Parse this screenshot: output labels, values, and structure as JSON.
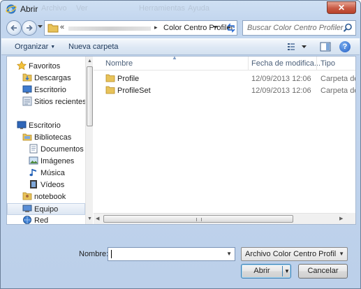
{
  "window": {
    "title": "Abrir",
    "ghost_menu": [
      "Archivo",
      "Ver",
      "Herramientas",
      "Ayuda"
    ],
    "close_glyph": "✕"
  },
  "address": {
    "chevron": "«",
    "separator": "▸",
    "current_folder": "Color Centro Profiler",
    "search_placeholder": "Buscar Color Centro Profiler"
  },
  "toolbar": {
    "organize_label": "Organizar",
    "new_folder_label": "Nueva carpeta",
    "help_glyph": "?"
  },
  "nav": {
    "items": [
      {
        "label": "Favoritos",
        "icon": "star-icon"
      },
      {
        "label": "Descargas",
        "icon": "downloads-folder-icon"
      },
      {
        "label": "Escritorio",
        "icon": "desktop-icon"
      },
      {
        "label": "Sitios recientes",
        "icon": "recent-places-icon"
      },
      {
        "label": "Escritorio",
        "icon": "desktop-icon"
      },
      {
        "label": "Bibliotecas",
        "icon": "libraries-icon"
      },
      {
        "label": "Documentos",
        "icon": "documents-icon"
      },
      {
        "label": "Imágenes",
        "icon": "pictures-icon"
      },
      {
        "label": "Música",
        "icon": "music-icon"
      },
      {
        "label": "Vídeos",
        "icon": "videos-icon"
      },
      {
        "label": "notebook",
        "icon": "user-folder-icon"
      },
      {
        "label": "Equipo",
        "icon": "computer-icon"
      },
      {
        "label": "Red",
        "icon": "network-icon"
      }
    ]
  },
  "files": {
    "columns": {
      "name": "Nombre",
      "date": "Fecha de modifica...",
      "type": "Tipo"
    },
    "rows": [
      {
        "name": "Profile",
        "date": "12/09/2013 12:06",
        "type": "Carpeta de a"
      },
      {
        "name": "ProfileSet",
        "date": "12/09/2013 12:06",
        "type": "Carpeta de a"
      }
    ]
  },
  "footer": {
    "name_label": "Nombre:",
    "name_value": "",
    "file_type": "Archivo Color Centro Profiler Ir",
    "open_label": "Abrir",
    "cancel_label": "Cancelar"
  },
  "colors": {
    "chrome": "#c3d6ee",
    "selection": "#dde7f3",
    "folder": "#e8c35a"
  }
}
